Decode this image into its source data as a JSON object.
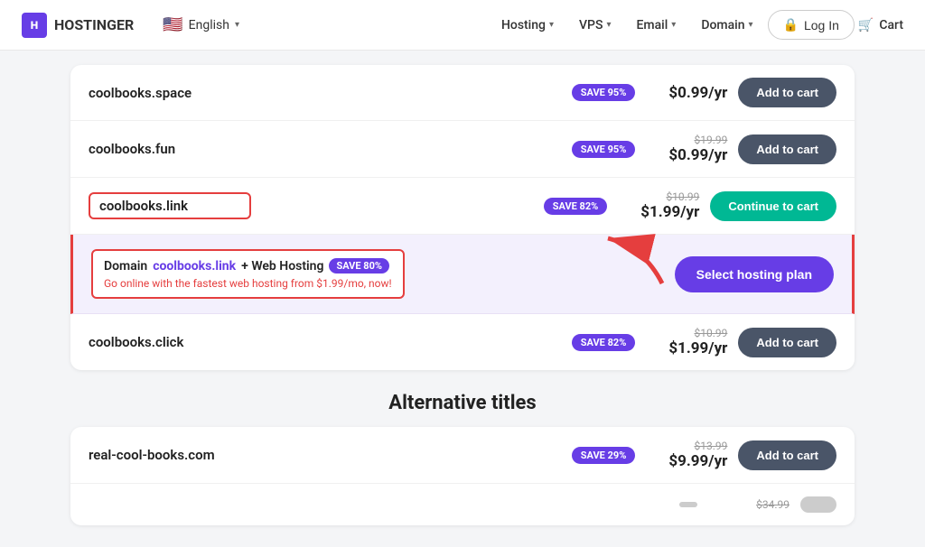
{
  "navbar": {
    "logo_text": "HOSTINGER",
    "lang": "English",
    "nav_items": [
      {
        "label": "Hosting",
        "has_chevron": true
      },
      {
        "label": "VPS",
        "has_chevron": true
      },
      {
        "label": "Email",
        "has_chevron": true
      },
      {
        "label": "Domain",
        "has_chevron": true
      }
    ],
    "login_label": "Log In",
    "cart_label": "Cart"
  },
  "domain_results": {
    "rows": [
      {
        "domain": "coolbooks.space",
        "badge": "SAVE 95%",
        "original_price": "",
        "price": "$0.99/yr",
        "btn_label": "Add to cart",
        "btn_type": "add",
        "highlighted": false
      },
      {
        "domain": "coolbooks.fun",
        "badge": "SAVE 95%",
        "original_price": "$19.99",
        "price": "$0.99/yr",
        "btn_label": "Add to cart",
        "btn_type": "add",
        "highlighted": false
      },
      {
        "domain": "coolbooks.link",
        "badge": "SAVE 82%",
        "original_price": "$10.99",
        "price": "$1.99/yr",
        "btn_label": "Continue to cart",
        "btn_type": "continue",
        "highlighted": true
      },
      {
        "domain": "coolbooks.click",
        "badge": "SAVE 82%",
        "original_price": "$10.99",
        "price": "$1.99/yr",
        "btn_label": "Add to cart",
        "btn_type": "add",
        "highlighted": false
      }
    ],
    "bundle": {
      "prefix": "Domain",
      "domain_link": "coolbooks.link",
      "suffix": "+ Web Hosting",
      "badge": "SAVE 80%",
      "subtitle": "Go online with the fastest web hosting from $1.99/mo, now!",
      "btn_label": "Select hosting plan"
    }
  },
  "alternative_section": {
    "title": "Alternative titles",
    "rows": [
      {
        "domain": "real-cool-books.com",
        "badge": "SAVE 29%",
        "original_price": "$13.99",
        "price": "$9.99/yr",
        "btn_label": "Add to cart",
        "btn_type": "add"
      },
      {
        "domain": "",
        "badge": "",
        "original_price": "$34.99",
        "price": "",
        "btn_label": "",
        "btn_type": "add"
      }
    ]
  }
}
